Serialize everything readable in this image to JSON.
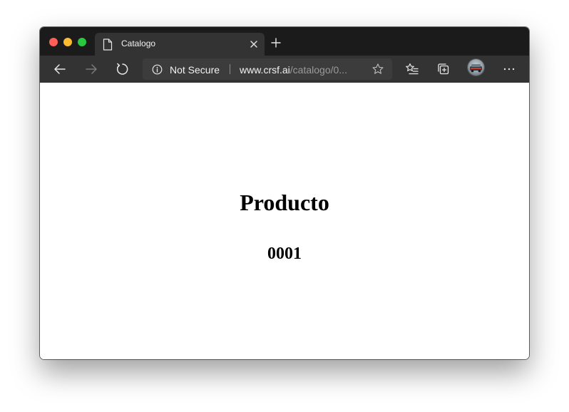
{
  "window": {
    "traffic_lights": {
      "close_color": "#ff5f57",
      "minimize_color": "#febc2e",
      "zoom_color": "#28c840"
    }
  },
  "tab": {
    "title": "Catalogo",
    "icon": "page-icon",
    "close_icon": "close-icon"
  },
  "new_tab_icon": "plus-icon",
  "toolbar": {
    "back_icon": "arrow-left-icon",
    "forward_icon": "arrow-right-icon",
    "reload_icon": "reload-icon",
    "favorites_icon": "favorites-list-icon",
    "collections_icon": "collections-icon",
    "profile_icon": "profile-avatar",
    "more_icon": "more-dots-icon"
  },
  "address_bar": {
    "info_icon": "info-icon",
    "security_label": "Not Secure",
    "url_domain": "www.crsf.ai",
    "url_path": "/catalogo/0",
    "url_ellipsis": "...",
    "star_icon": "star-icon"
  },
  "page": {
    "heading": "Producto",
    "subheading": "0001"
  }
}
